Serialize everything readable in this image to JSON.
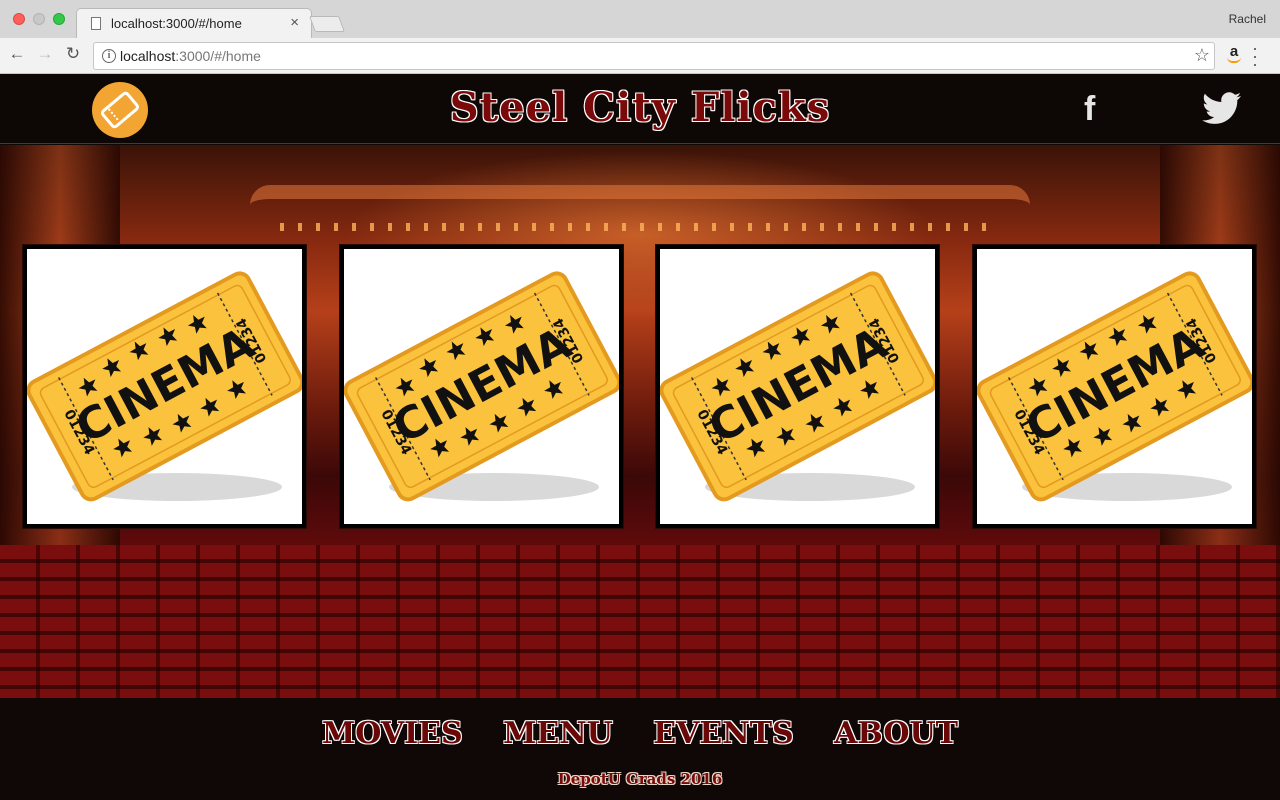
{
  "browser": {
    "tab_title": "localhost:3000/#/home",
    "tab_close": "×",
    "profile_name": "Rachel",
    "url_host": "localhost",
    "url_rest": ":3000/#/home",
    "icons": [
      "back-arrow-icon",
      "forward-arrow-icon",
      "reload-icon",
      "info-icon",
      "star-icon",
      "amazon-icon",
      "menu-icon"
    ]
  },
  "header": {
    "site_title": "Steel City Flicks",
    "logo_icon": "ticket-icon",
    "social_icons": [
      "facebook-icon",
      "twitter-icon"
    ],
    "facebook_glyph": "f"
  },
  "cards": [
    {
      "ticket_text": "CINEMA",
      "ticket_number": "01234"
    },
    {
      "ticket_text": "CINEMA",
      "ticket_number": "01234"
    },
    {
      "ticket_text": "CINEMA",
      "ticket_number": "01234"
    },
    {
      "ticket_text": "CINEMA",
      "ticket_number": "01234"
    }
  ],
  "footer": {
    "nav": [
      "MOVIES",
      "MENU",
      "EVENTS",
      "ABOUT"
    ],
    "credit": "DepotU Grads 2016"
  },
  "colors": {
    "ticket_yellow": "#fbc23d",
    "ticket_border": "#e39a1f",
    "logo_orange": "#f3a533",
    "title_red": "#7a0a0a"
  }
}
